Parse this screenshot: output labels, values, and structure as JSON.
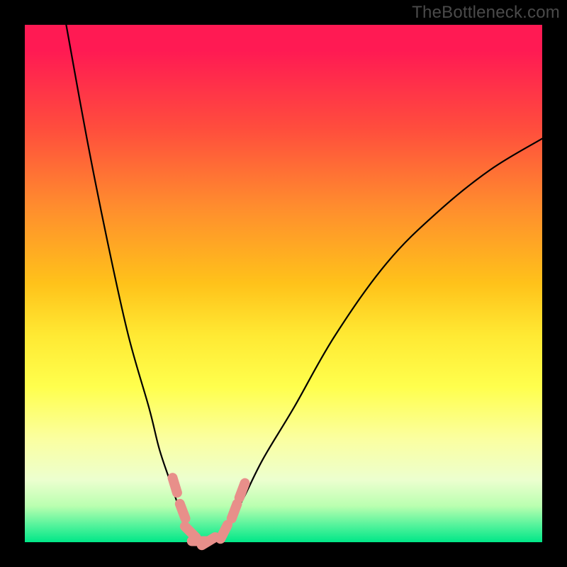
{
  "watermark": "TheBottleneck.com",
  "colors": {
    "page_bg": "#000000",
    "gradient_top": "#ff1a53",
    "gradient_bottom": "#00e788",
    "curve_stroke": "#000000",
    "marker_fill": "#e88f8a",
    "watermark_text": "#4a4a4a"
  },
  "chart_data": {
    "type": "line",
    "title": "",
    "xlabel": "",
    "ylabel": "",
    "xlim": [
      0,
      100
    ],
    "ylim": [
      0,
      100
    ],
    "grid": false,
    "legend": false,
    "background": "rainbow-gradient-red-top-green-bottom",
    "series": [
      {
        "name": "left-curve",
        "x": [
          8,
          12,
          16,
          20,
          24,
          26,
          28,
          30,
          31,
          32,
          33
        ],
        "y": [
          100,
          78,
          58,
          40,
          26,
          18,
          12,
          6,
          3,
          1,
          0
        ]
      },
      {
        "name": "right-curve",
        "x": [
          37,
          39,
          42,
          46,
          52,
          60,
          70,
          80,
          90,
          100
        ],
        "y": [
          0,
          3,
          8,
          16,
          26,
          40,
          54,
          64,
          72,
          78
        ]
      },
      {
        "name": "bottom-flat",
        "x": [
          33,
          34,
          35,
          36,
          37
        ],
        "y": [
          0,
          0,
          0,
          0,
          0
        ]
      }
    ],
    "markers": {
      "name": "salmon-markers",
      "description": "short pink/salmon segments near the valley bottom",
      "points": [
        {
          "x": 29.0,
          "y": 11.0
        },
        {
          "x": 30.5,
          "y": 6.0
        },
        {
          "x": 32.0,
          "y": 2.0
        },
        {
          "x": 33.8,
          "y": 0.2
        },
        {
          "x": 35.5,
          "y": 0.2
        },
        {
          "x": 38.5,
          "y": 2.0
        },
        {
          "x": 40.5,
          "y": 6.0
        },
        {
          "x": 42.0,
          "y": 10.0
        }
      ]
    }
  }
}
